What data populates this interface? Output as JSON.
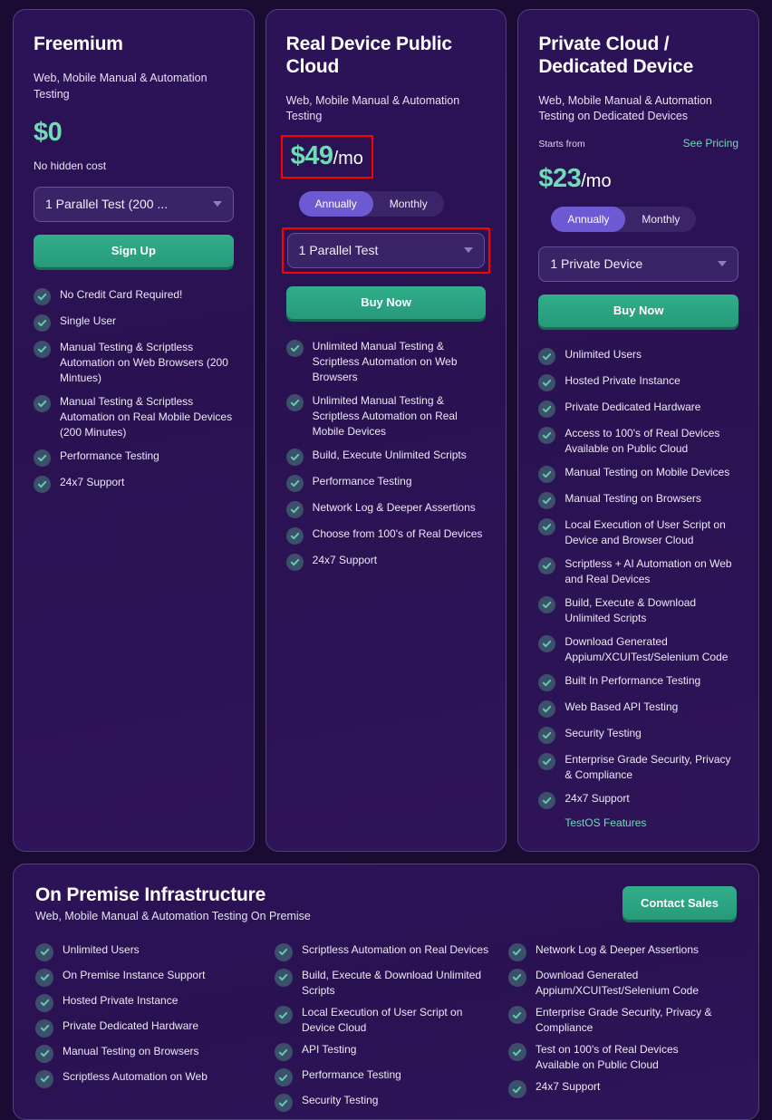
{
  "colors": {
    "page_bg": "#1a0b33",
    "card_bg": "#2c1257",
    "card_border": "#54407e",
    "accent_green": "#6fdcb6",
    "cta_green": "#279a79",
    "toggle_active": "#6d5ad3",
    "annotation_red": "#ff0000",
    "check_circle": "#3c4f6b"
  },
  "plans": [
    {
      "id": "freemium",
      "title": "Freemium",
      "subtitle": "Web, Mobile Manual & Automation Testing",
      "price": "$0",
      "price_unit": "",
      "price_note": "No hidden cost",
      "has_toggle": false,
      "starts_from": "",
      "see_pricing": "",
      "select_value": "1 Parallel Test (200 ...",
      "cta_label": "Sign Up",
      "highlight_price": false,
      "highlight_select": false,
      "features": [
        "No Credit Card Required!",
        "Single User",
        "Manual Testing & Scriptless Automation on Web Browsers (200 Mintues)",
        "Manual Testing & Scriptless Automation on Real Mobile Devices (200 Minutes)",
        "Performance Testing",
        "24x7 Support"
      ],
      "footer_link": ""
    },
    {
      "id": "real-device-public-cloud",
      "title": "Real Device Public Cloud",
      "subtitle": "Web, Mobile Manual & Automation Testing",
      "price": "$49",
      "price_unit": "/mo",
      "price_note": "",
      "has_toggle": true,
      "toggle": {
        "annually": "Annually",
        "monthly": "Monthly",
        "selected": "Annually"
      },
      "starts_from": "",
      "see_pricing": "",
      "select_value": "1 Parallel Test",
      "cta_label": "Buy Now",
      "highlight_price": true,
      "highlight_select": true,
      "features": [
        "Unlimited Manual Testing & Scriptless Automation on Web Browsers",
        "Unlimited Manual Testing & Scriptless Automation on Real Mobile Devices",
        "Build, Execute Unlimited Scripts",
        "Performance Testing",
        "Network Log & Deeper Assertions",
        "Choose from 100's of Real Devices",
        "24x7 Support"
      ],
      "footer_link": ""
    },
    {
      "id": "private-cloud-dedicated-device",
      "title": "Private Cloud / Dedicated Device",
      "subtitle": "Web, Mobile Manual & Automation Testing on Dedicated Devices",
      "price": "$23",
      "price_unit": "/mo",
      "price_note": "",
      "has_toggle": true,
      "toggle": {
        "annually": "Annually",
        "monthly": "Monthly",
        "selected": "Annually"
      },
      "starts_from": "Starts from",
      "see_pricing": "See Pricing",
      "select_value": "1 Private Device",
      "cta_label": "Buy Now",
      "highlight_price": false,
      "highlight_select": false,
      "features": [
        "Unlimited Users",
        "Hosted Private Instance",
        "Private Dedicated Hardware",
        "Access to 100's of Real Devices Available on Public Cloud",
        "Manual Testing on Mobile Devices",
        "Manual Testing on Browsers",
        "Local Execution of User Script on Device and Browser Cloud",
        "Scriptless + AI Automation on Web and Real Devices",
        "Build, Execute & Download Unlimited Scripts",
        "Download Generated Appium/XCUITest/Selenium Code",
        "Built In Performance Testing",
        "Web Based API Testing",
        "Security Testing",
        "Enterprise Grade Security, Privacy & Compliance",
        "24x7 Support"
      ],
      "footer_link": "TestOS Features"
    }
  ],
  "onpremise": {
    "title": "On Premise Infrastructure",
    "subtitle": "Web, Mobile Manual & Automation Testing On Premise",
    "cta_label": "Contact Sales",
    "columns": [
      [
        "Unlimited Users",
        "On Premise Instance Support",
        "Hosted Private Instance",
        "Private Dedicated Hardware",
        "Manual Testing on Browsers",
        "Scriptless Automation on Web"
      ],
      [
        "Scriptless Automation on Real Devices",
        "Build, Execute & Download Unlimited Scripts",
        "Local Execution of User Script on Device Cloud",
        "API Testing",
        "Performance Testing",
        "Security Testing"
      ],
      [
        "Network Log & Deeper Assertions",
        "Download Generated Appium/XCUITest/Selenium Code",
        "Enterprise Grade Security, Privacy & Compliance",
        "Test on 100's of Real Devices Available on Public Cloud",
        "24x7 Support"
      ]
    ]
  }
}
